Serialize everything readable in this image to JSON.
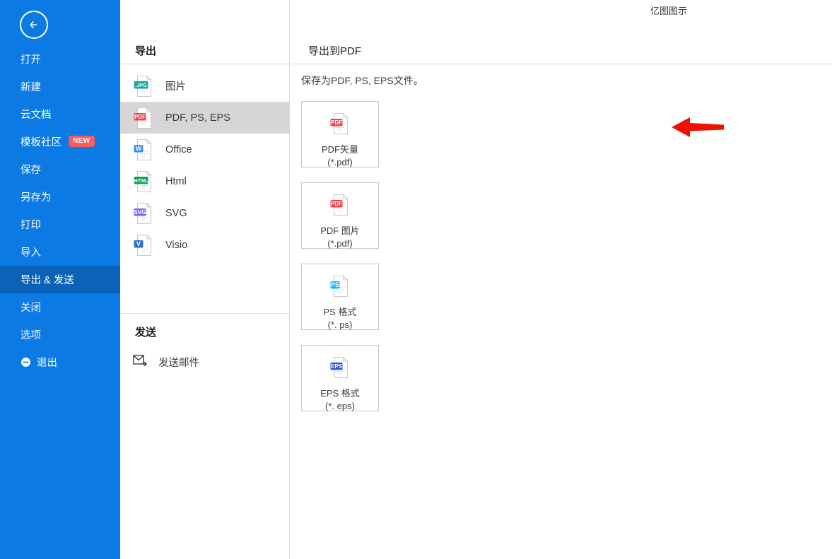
{
  "watermark": {
    "text": "亿图图示"
  },
  "sidebar": {
    "back_button": {
      "icon": "arrow-left-circle-icon"
    },
    "accent_color": "#0c7ae5",
    "active_color": "#0a63b8",
    "items": [
      {
        "label": "打开",
        "name": "open",
        "active": false,
        "badge": null,
        "icon": null
      },
      {
        "label": "新建",
        "name": "new",
        "active": false,
        "badge": null,
        "icon": null
      },
      {
        "label": "云文档",
        "name": "cloud-docs",
        "active": false,
        "badge": null,
        "icon": null
      },
      {
        "label": "模板社区",
        "name": "template-community",
        "active": false,
        "badge": "NEW",
        "icon": null
      },
      {
        "label": "保存",
        "name": "save",
        "active": false,
        "badge": null,
        "icon": null
      },
      {
        "label": "另存为",
        "name": "save-as",
        "active": false,
        "badge": null,
        "icon": null
      },
      {
        "label": "打印",
        "name": "print",
        "active": false,
        "badge": null,
        "icon": null
      },
      {
        "label": "导入",
        "name": "import",
        "active": false,
        "badge": null,
        "icon": null
      },
      {
        "label": "导出 & 发送",
        "name": "export-and-send",
        "active": true,
        "badge": null,
        "icon": null
      },
      {
        "label": "关闭",
        "name": "close",
        "active": false,
        "badge": null,
        "icon": null
      },
      {
        "label": "选项",
        "name": "options",
        "active": false,
        "badge": null,
        "icon": null
      },
      {
        "label": "退出",
        "name": "exit",
        "active": false,
        "badge": null,
        "icon": "exit-circle-icon"
      }
    ],
    "badge_color": "#fc5b5b"
  },
  "export_panel": {
    "title": "导出",
    "items": [
      {
        "label": "图片",
        "icon": "jpg-file-icon",
        "badge_text": ".JPG",
        "badge_color": "#12a89d",
        "selected": false
      },
      {
        "label": "PDF, PS, EPS",
        "icon": "pdf-file-icon",
        "badge_text": "PDF",
        "badge_color": "#f4414c",
        "selected": true
      },
      {
        "label": "Office",
        "icon": "word-file-icon",
        "badge_text": "W",
        "badge_color": "#2f8ef4",
        "selected": false
      },
      {
        "label": "Html",
        "icon": "html-file-icon",
        "badge_text": "HTML",
        "badge_color": "#12a05c",
        "selected": false
      },
      {
        "label": "SVG",
        "icon": "svg-file-icon",
        "badge_text": "SVG",
        "badge_color": "#7b68ee",
        "selected": false
      },
      {
        "label": "Visio",
        "icon": "visio-file-icon",
        "badge_text": "V",
        "badge_color": "#2f6fd0",
        "selected": false
      }
    ],
    "selected_bg": "#d6d6d6"
  },
  "send_panel": {
    "title": "发送",
    "items": [
      {
        "label": "发送邮件",
        "icon": "send-mail-icon"
      }
    ]
  },
  "main": {
    "title": "导出到PDF",
    "description": "保存为PDF, PS, EPS文件。",
    "cards": [
      {
        "line1": "PDF矢量",
        "line2": "(*.pdf)",
        "icon": "pdf-file-icon",
        "badge_text": "PDF",
        "badge_color": "#f4414c"
      },
      {
        "line1": "PDF 图片",
        "line2": "(*.pdf)",
        "icon": "pdf-file-icon",
        "badge_text": "PDF",
        "badge_color": "#f4414c"
      },
      {
        "line1": "PS 格式",
        "line2": "(*. ps)",
        "icon": "ps-file-icon",
        "badge_text": "PS",
        "badge_color": "#12b7e0"
      },
      {
        "line1": "EPS 格式",
        "line2": "(*. eps)",
        "icon": "eps-file-icon",
        "badge_text": "EPS",
        "badge_color": "#3355dd"
      }
    ]
  },
  "annotation": {
    "arrow": {
      "name": "red-pointer-arrow",
      "direction": "left",
      "color": "#ee1100"
    }
  }
}
